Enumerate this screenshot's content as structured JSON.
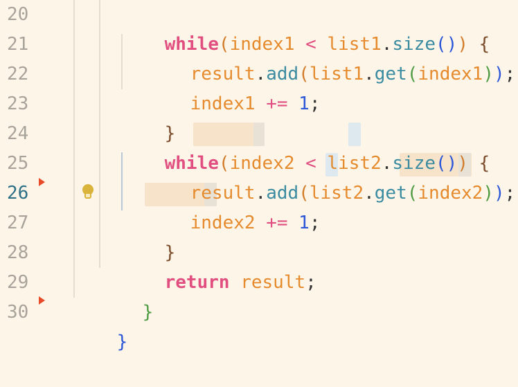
{
  "editor": {
    "line_numbers": [
      "20",
      "21",
      "22",
      "23",
      "24",
      "25",
      "26",
      "27",
      "28",
      "29",
      "30"
    ],
    "active_line": "26",
    "code": {
      "line20": {
        "kw": "while",
        "p1": "(",
        "var1": "index1",
        "op": " < ",
        "var2": "list1",
        "dot": ".",
        "fn": "size",
        "p2": "()",
        "p3": ")",
        "brace": " {"
      },
      "line21": {
        "var1": "result",
        "dot1": ".",
        "fn1": "add",
        "p1": "(",
        "var2": "list1",
        "dot2": ".",
        "fn2": "get",
        "p2": "(",
        "var3": "index1",
        "p3": ")",
        "p4": ")",
        "semi": ";"
      },
      "line22": {
        "var1": "index1",
        "op": " += ",
        "num": "1",
        "semi": ";"
      },
      "line23": {
        "brace": "}"
      },
      "line24": {
        "kw": "while",
        "p1": "(",
        "var1": "index2",
        "op": " < ",
        "var2": "list2",
        "dot": ".",
        "fn": "size",
        "p2": "()",
        "p3": ")",
        "brace": " {"
      },
      "line25": {
        "var1": "result",
        "dot1": ".",
        "fn1": "add",
        "p1": "(",
        "var2": "list2",
        "dot2": ".",
        "fn2": "get",
        "p2": "(",
        "var3": "index2",
        "p3": ")",
        "p4": ")",
        "semi": ";"
      },
      "line26": {
        "var1": "index2",
        "op": " += ",
        "num": "1",
        "semi": ";"
      },
      "line27": {
        "brace": "}"
      },
      "line28": {
        "kw": "return",
        "space": " ",
        "var": "result",
        "semi": ";"
      },
      "line29": {
        "brace": "}"
      },
      "line30": {
        "brace": "}"
      }
    },
    "icons": {
      "lightbulb": "lightbulb-icon",
      "fold": "fold-marker-icon"
    },
    "colors": {
      "background": "#fdf6e8",
      "keyword": "#e14f80",
      "function": "#3a8aa0",
      "variable": "#e58a2d",
      "number": "#2b56d8",
      "line_number": "#a8a39a",
      "active_line_number": "#2e6f86",
      "fold_marker": "#e84b2a",
      "lightbulb": "#d9b33a"
    }
  }
}
